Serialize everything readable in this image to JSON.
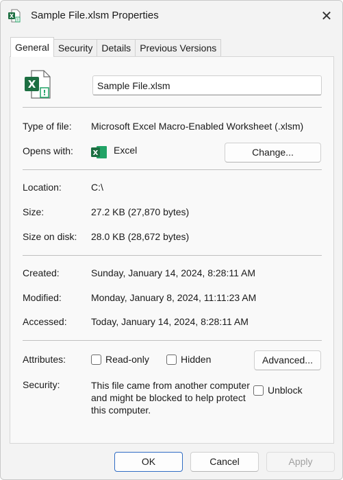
{
  "window": {
    "title": "Sample File.xlsm Properties",
    "icon": "excel-macro-file-icon",
    "close_glyph": "✕"
  },
  "tabs": [
    {
      "label": "General",
      "active": true
    },
    {
      "label": "Security",
      "active": false
    },
    {
      "label": "Details",
      "active": false
    },
    {
      "label": "Previous Versions",
      "active": false
    }
  ],
  "general": {
    "file_name": "Sample File.xlsm",
    "type_label": "Type of file:",
    "type_value": "Microsoft Excel Macro-Enabled Worksheet (.xlsm)",
    "opens_label": "Opens with:",
    "opens_app": "Excel",
    "change_button": "Change...",
    "location_label": "Location:",
    "location_value": "C:\\",
    "size_label": "Size:",
    "size_value": "27.2 KB (27,870 bytes)",
    "size_on_disk_label": "Size on disk:",
    "size_on_disk_value": "28.0 KB (28,672 bytes)",
    "created_label": "Created:",
    "created_value": "Sunday, January 14, 2024, 8:28:11 AM",
    "modified_label": "Modified:",
    "modified_value": "Monday, January 8, 2024, 11:11:23 AM",
    "accessed_label": "Accessed:",
    "accessed_value": "Today, January 14, 2024, 8:28:11 AM",
    "attributes_label": "Attributes:",
    "readonly_label": "Read-only",
    "readonly_checked": false,
    "hidden_label": "Hidden",
    "hidden_checked": false,
    "advanced_button": "Advanced...",
    "security_label": "Security:",
    "security_text": "This file came from another computer and might be blocked to help protect this computer.",
    "unblock_label": "Unblock",
    "unblock_checked": false
  },
  "footer": {
    "ok": "OK",
    "cancel": "Cancel",
    "apply": "Apply"
  },
  "colors": {
    "excel_green": "#1d6f42",
    "accent_blue": "#2f6cc4",
    "warning_green": "#21a366"
  }
}
